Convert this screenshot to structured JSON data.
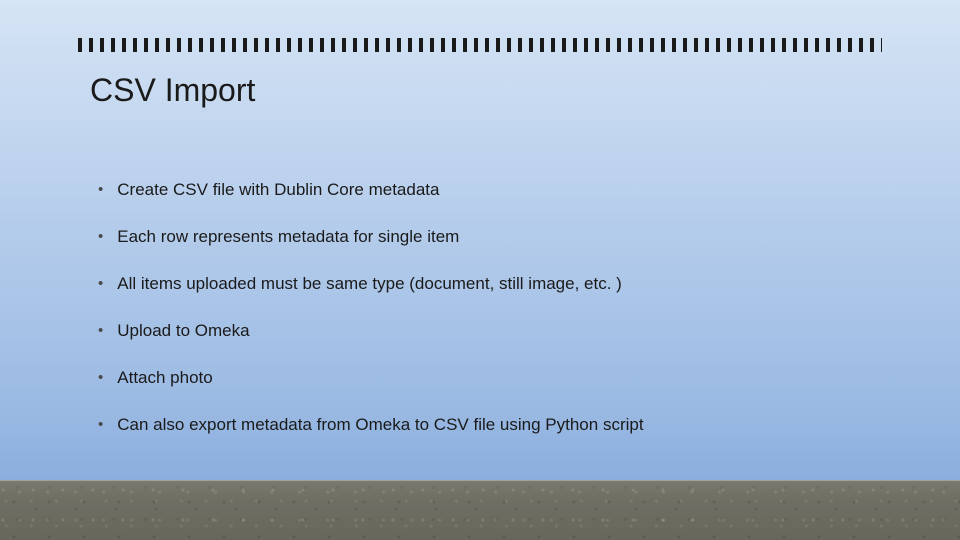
{
  "slide": {
    "title": "CSV Import",
    "bullets": [
      "Create CSV file with Dublin Core metadata",
      "Each row represents metadata for single item",
      "All items uploaded must be same type (document, still image, etc. )",
      "Upload to Omeka",
      "Attach photo",
      "Can also export metadata from Omeka to CSV file using Python script"
    ]
  }
}
